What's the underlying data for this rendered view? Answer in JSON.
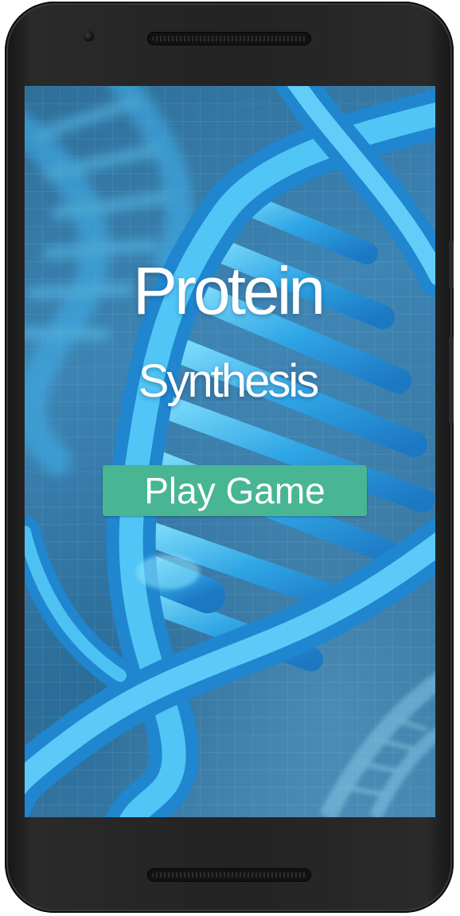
{
  "app": {
    "title_line1": "Protein",
    "title_line2": "Synthesis",
    "play_button_label": "Play Game"
  },
  "colors": {
    "bezel": "#232323",
    "background_blue": "#3d84b3",
    "dna_glow": "#4fc4f5",
    "button_green": "#48b593",
    "text": "#ffffff"
  },
  "icons": {
    "background": "dna-helix-image",
    "front_camera": "camera-icon",
    "earpiece": "speaker-grille"
  }
}
